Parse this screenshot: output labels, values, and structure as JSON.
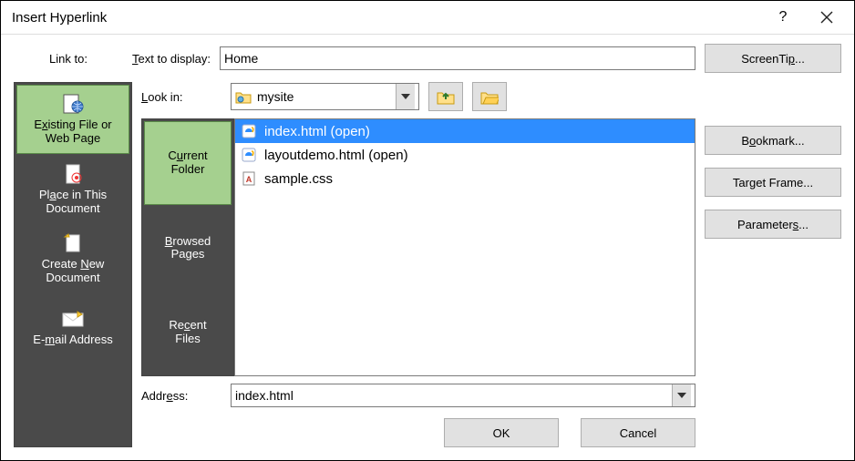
{
  "title": "Insert Hyperlink",
  "link_to_label": "Link to:",
  "text_to_display": {
    "label": "Text to display:",
    "value": "Home"
  },
  "screentip_button": "ScreenTip...",
  "look_in": {
    "label": "Look in:",
    "value": "mysite"
  },
  "link_to_items": [
    {
      "label_line1": "Existing File or",
      "label_line2": "Web Page",
      "selected": true,
      "icon": "globe-page"
    },
    {
      "label_line1": "Place in This",
      "label_line2": "Document",
      "selected": false,
      "icon": "doc-target"
    },
    {
      "label_line1": "Create New",
      "label_line2": "Document",
      "selected": false,
      "icon": "doc-new"
    },
    {
      "label_line1": "E-mail Address",
      "label_line2": "",
      "selected": false,
      "icon": "mail"
    }
  ],
  "browse_tabs": [
    {
      "label_line1": "Current",
      "label_line2": "Folder",
      "selected": true
    },
    {
      "label_line1": "Browsed",
      "label_line2": "Pages",
      "selected": false
    },
    {
      "label_line1": "Recent",
      "label_line2": "Files",
      "selected": false
    }
  ],
  "files": [
    {
      "name": "index.html (open)",
      "icon": "ie",
      "selected": true
    },
    {
      "name": "layoutdemo.html (open)",
      "icon": "ie",
      "selected": false
    },
    {
      "name": "sample.css",
      "icon": "css",
      "selected": false
    }
  ],
  "address": {
    "label": "Address:",
    "value": "index.html"
  },
  "right_buttons": {
    "bookmark": "Bookmark...",
    "target_frame": "Target Frame...",
    "parameters": "Parameters..."
  },
  "footer": {
    "ok": "OK",
    "cancel": "Cancel"
  }
}
